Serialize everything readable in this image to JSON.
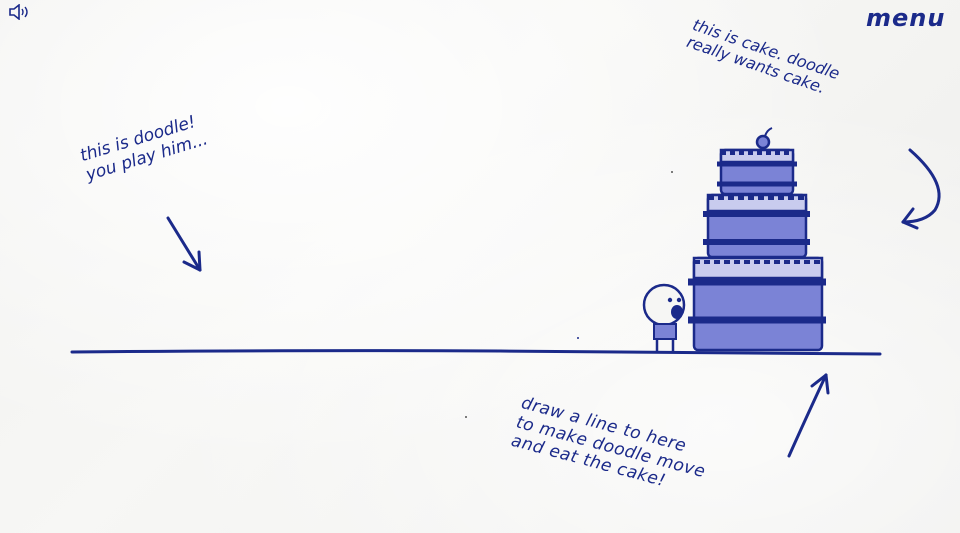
{
  "menu": {
    "label": "menu"
  },
  "sound": {
    "icon": "speaker-icon"
  },
  "notes": {
    "doodle_intro": "this is doodle!\nyou play him...",
    "cake_intro": "this is cake. doodle\nreally wants cake.",
    "instruction": "draw a line to here\nto make doodle move\nand eat the cake!"
  },
  "colors": {
    "ink": "#1b2a8a",
    "cake_fill": "#7b83d6",
    "paper": "#f4f4f2"
  }
}
